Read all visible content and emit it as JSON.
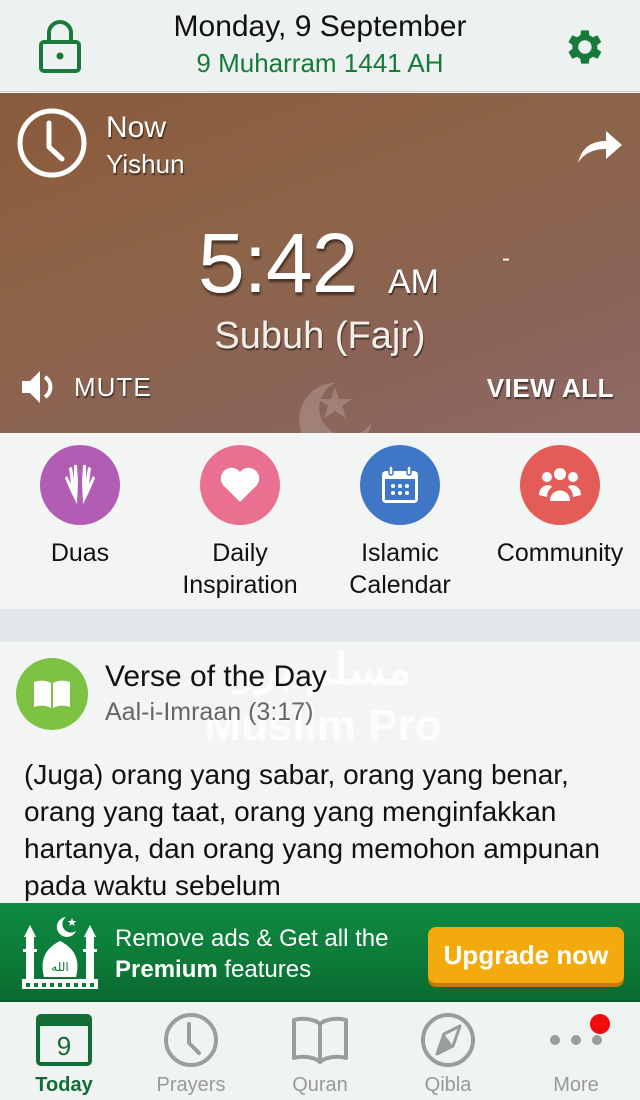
{
  "header": {
    "date": "Monday, 9 September",
    "hijri_date": "9 Muharram 1441 AH",
    "accent_color": "#177a3a"
  },
  "hero": {
    "status": "Now",
    "location": "Yishun",
    "time": "5:42",
    "ampm": "AM",
    "countdown": "-",
    "prayer_name": "Subuh (Fajr)",
    "mute_label": "MUTE",
    "view_all_label": "VIEW ALL"
  },
  "quick_actions": [
    {
      "label_line1": "Duas",
      "label_line2": "",
      "icon": "praying-hands-icon",
      "color": "#b15db3"
    },
    {
      "label_line1": "Daily",
      "label_line2": "Inspiration",
      "icon": "heart-icon",
      "color": "#e97090"
    },
    {
      "label_line1": "Islamic",
      "label_line2": "Calendar",
      "icon": "calendar-icon",
      "color": "#3f77c6"
    },
    {
      "label_line1": "Community",
      "label_line2": "",
      "icon": "community-icon",
      "color": "#e45c58"
    }
  ],
  "verse": {
    "title": "Verse of the Day",
    "reference": "Aal-i-Imraan (3:17)",
    "text": "(Juga) orang yang sabar, orang yang benar, orang yang taat, orang yang menginfakkan hartanya, dan orang yang memohon ampunan pada waktu sebelum",
    "watermark_arabic": "مسلم برو",
    "watermark_latin": "Muslim Pro"
  },
  "promo": {
    "line1": "Remove ads & Get all the",
    "line2_bold": "Premium",
    "line2_rest": " features",
    "button_label": "Upgrade now",
    "button_color": "#f3aa0d"
  },
  "tabbar": {
    "items": [
      {
        "label": "Today",
        "icon": "calendar-day-icon",
        "day": "9",
        "active": true
      },
      {
        "label": "Prayers",
        "icon": "clock-icon",
        "active": false
      },
      {
        "label": "Quran",
        "icon": "book-icon",
        "active": false
      },
      {
        "label": "Qibla",
        "icon": "compass-icon",
        "active": false
      },
      {
        "label": "More",
        "icon": "more-dots-icon",
        "active": false,
        "badge": true
      }
    ]
  }
}
